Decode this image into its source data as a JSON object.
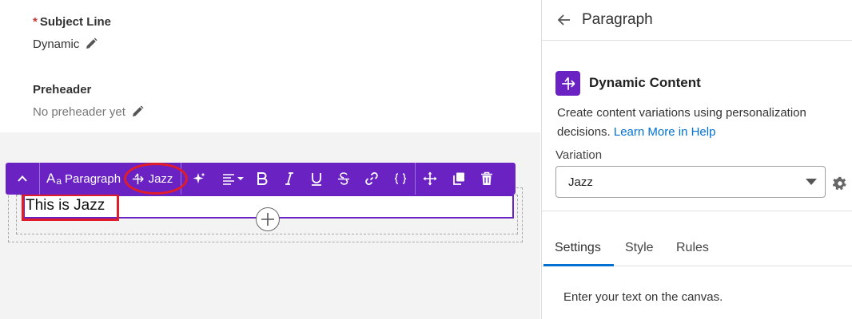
{
  "email": {
    "subject_label": "Subject Line",
    "subject_required_mark": "*",
    "subject_value": "Dynamic",
    "preheader_label": "Preheader",
    "preheader_value": "No preheader yet"
  },
  "toolbar": {
    "block_type_label": "Paragraph",
    "variation_label": "Jazz",
    "block_type_glyph": "A",
    "block_type_glyph_small": "a"
  },
  "canvas": {
    "text": "This is Jazz"
  },
  "panel": {
    "title": "Paragraph",
    "section_title": "Dynamic Content",
    "description": "Create content variations using personalization decisions.",
    "learn_more_link": "Learn More in Help",
    "variation_label": "Variation",
    "variation_selected": "Jazz",
    "tabs": [
      {
        "label": "Settings",
        "active": true
      },
      {
        "label": "Style",
        "active": false
      },
      {
        "label": "Rules",
        "active": false
      }
    ],
    "hint": "Enter your text on the canvas."
  },
  "colors": {
    "toolbar_purple": "#6b22c3",
    "annotation_red": "#e11d2a",
    "link_blue": "#0070d2"
  }
}
